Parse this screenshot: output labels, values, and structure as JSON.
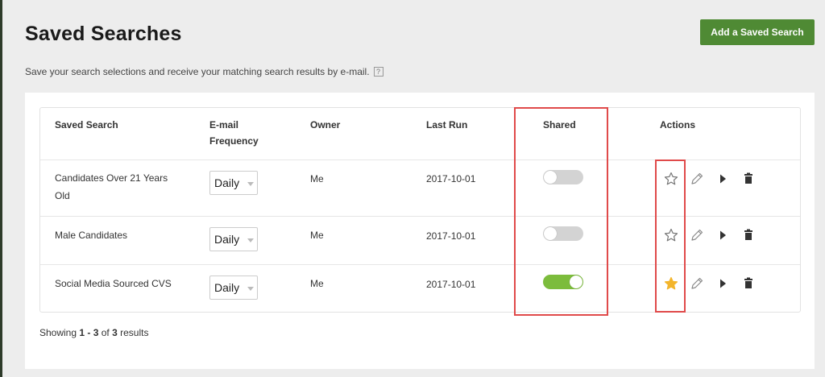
{
  "page": {
    "title": "Saved Searches",
    "subtitle": "Save your search selections and receive your matching search results by e-mail.",
    "help_icon": "?",
    "add_button": "Add a Saved Search"
  },
  "table": {
    "headers": {
      "saved_search": "Saved Search",
      "email_frequency_1": "E-mail",
      "email_frequency_2": "Frequency",
      "owner": "Owner",
      "last_run": "Last Run",
      "shared": "Shared",
      "actions": "Actions"
    },
    "rows": [
      {
        "name_1": "Candidates Over 21 Years",
        "name_2": "Old",
        "frequency": "Daily",
        "owner": "Me",
        "last_run": "2017-10-01",
        "shared": false,
        "favorite": false
      },
      {
        "name_1": "Male Candidates",
        "name_2": "",
        "frequency": "Daily",
        "owner": "Me",
        "last_run": "2017-10-01",
        "shared": false,
        "favorite": false
      },
      {
        "name_1": "Social Media Sourced CVS",
        "name_2": "",
        "frequency": "Daily",
        "owner": "Me",
        "last_run": "2017-10-01",
        "shared": true,
        "favorite": true
      }
    ],
    "action_icons": [
      "star-icon",
      "pencil-icon",
      "play-icon",
      "trash-icon"
    ]
  },
  "pagination": {
    "prefix": "Showing ",
    "from": "1",
    "sep": " - ",
    "to": "3",
    "of": " of ",
    "total": "3",
    "suffix": " results"
  },
  "colors": {
    "primary_button": "#4f8a34",
    "toggle_on": "#7cbc3c",
    "toggle_off": "#d3d3d3",
    "favorite_star": "#f3b52c",
    "highlight": "#e04a4a"
  }
}
